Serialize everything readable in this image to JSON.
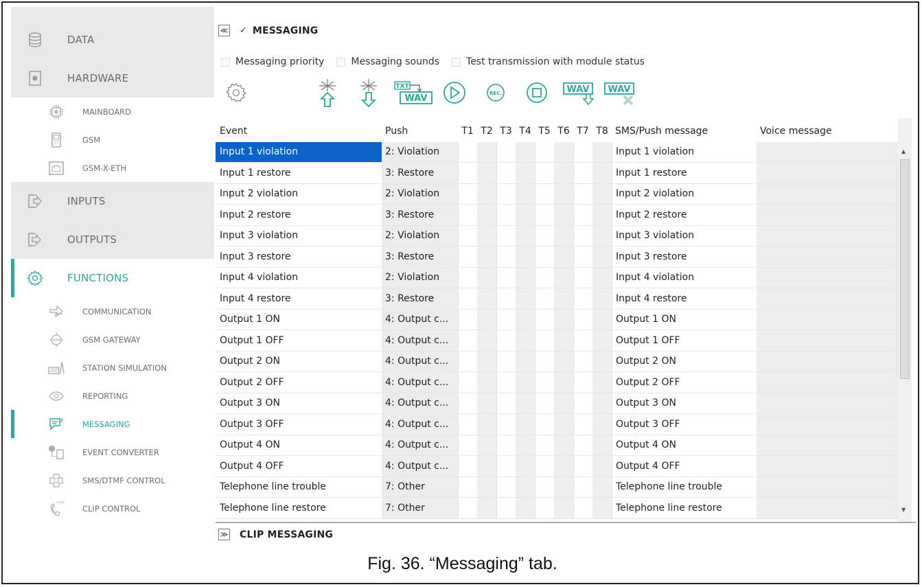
{
  "sidebar": {
    "main": {
      "data": "DATA",
      "hardware": "HARDWARE",
      "inputs": "INPUTS",
      "outputs": "OUTPUTS",
      "functions": "FUNCTIONS"
    },
    "hardware_sub": [
      "MAINBOARD",
      "GSM",
      "GSM-X-ETH"
    ],
    "functions_sub": [
      "COMMUNICATION",
      "GSM GATEWAY",
      "STATION SIMULATION",
      "REPORTING",
      "MESSAGING",
      "EVENT CONVERTER",
      "SMS/DTMF CONTROL",
      "CLIP CONTROL"
    ],
    "accent": "#2aa89a"
  },
  "section": {
    "collapse_glyph": "≪",
    "expand_glyph": "≫",
    "check_glyph": "✓",
    "title": "MESSAGING",
    "options": [
      "Messaging priority",
      "Messaging sounds",
      "Test transmission with module status"
    ],
    "toolbar_icons": [
      "gear-icon",
      "upload-icon",
      "download-icon",
      "txt-to-wav-icon",
      "play-icon",
      "record-icon",
      "stop-icon",
      "wav-download-icon",
      "wav-delete-icon"
    ],
    "toolbar_text": {
      "txt": "TXT",
      "wav": "WAV",
      "rec": "REC."
    },
    "second_title": "CLIP MESSAGING"
  },
  "grid": {
    "headers": {
      "event": "Event",
      "push": "Push",
      "t": [
        "T1",
        "T2",
        "T3",
        "T4",
        "T5",
        "T6",
        "T7",
        "T8"
      ],
      "sms": "SMS/Push message",
      "voice": "Voice message"
    },
    "rows": [
      {
        "event": "Input 1 violation",
        "push": "2: Violation",
        "sms": "Input 1 violation",
        "voice": ""
      },
      {
        "event": "Input 1 restore",
        "push": "3: Restore",
        "sms": "Input 1 restore",
        "voice": ""
      },
      {
        "event": "Input 2 violation",
        "push": "2: Violation",
        "sms": "Input 2 violation",
        "voice": ""
      },
      {
        "event": "Input 2 restore",
        "push": "3: Restore",
        "sms": "Input 2 restore",
        "voice": ""
      },
      {
        "event": "Input 3 violation",
        "push": "2: Violation",
        "sms": "Input 3 violation",
        "voice": ""
      },
      {
        "event": "Input 3 restore",
        "push": "3: Restore",
        "sms": "Input 3 restore",
        "voice": ""
      },
      {
        "event": "Input 4 violation",
        "push": "2: Violation",
        "sms": "Input 4 violation",
        "voice": ""
      },
      {
        "event": "Input 4 restore",
        "push": "3: Restore",
        "sms": "Input 4 restore",
        "voice": ""
      },
      {
        "event": "Output 1 ON",
        "push": "4: Output c...",
        "sms": "Output 1 ON",
        "voice": ""
      },
      {
        "event": "Output 1 OFF",
        "push": "4: Output c...",
        "sms": "Output 1 OFF",
        "voice": ""
      },
      {
        "event": "Output 2 ON",
        "push": "4: Output c...",
        "sms": "Output 2 ON",
        "voice": ""
      },
      {
        "event": "Output 2 OFF",
        "push": "4: Output c...",
        "sms": "Output 2 OFF",
        "voice": ""
      },
      {
        "event": "Output 3 ON",
        "push": "4: Output c...",
        "sms": "Output 3 ON",
        "voice": ""
      },
      {
        "event": "Output 3 OFF",
        "push": "4: Output c...",
        "sms": "Output 3 OFF",
        "voice": ""
      },
      {
        "event": "Output 4 ON",
        "push": "4: Output c...",
        "sms": "Output 4 ON",
        "voice": ""
      },
      {
        "event": "Output 4 OFF",
        "push": "4: Output c...",
        "sms": "Output 4 OFF",
        "voice": ""
      },
      {
        "event": "Telephone line trouble",
        "push": "7: Other",
        "sms": "Telephone line trouble",
        "voice": ""
      },
      {
        "event": "Telephone line restore",
        "push": "7: Other",
        "sms": "Telephone line restore",
        "voice": ""
      }
    ],
    "selected_row": 0,
    "selection_color": "#0a63c9"
  },
  "caption": "Fig. 36. “Messaging” tab."
}
